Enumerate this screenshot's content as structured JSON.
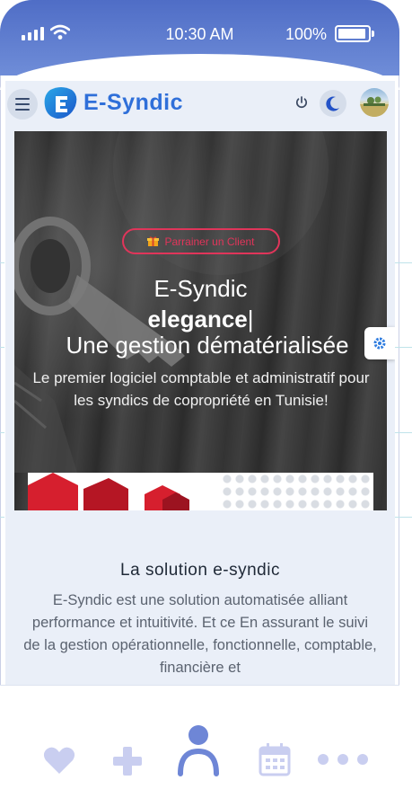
{
  "status_bar": {
    "time": "10:30 AM",
    "battery": "100%"
  },
  "header": {
    "brand": "E-Syndic"
  },
  "hero": {
    "cta": "Parrainer un Client",
    "title": "E-Syndic",
    "typed": "elegance",
    "cursor": "|",
    "subtitle": "Une gestion dématérialisée",
    "description": "Le premier logiciel comptable et administratif pour les syndics de copropriété en Tunisie!"
  },
  "section": {
    "title": "La solution e-syndic",
    "text": "E-Syndic est une solution automatisée alliant performance et intuitivité. Et ce En assurant le suivi de la gestion opérationnelle, fonctionnelle, comptable, financière et"
  },
  "colors": {
    "brand": "#2f6fd9",
    "status_bar": "#5c7ad0",
    "cta": "#e0355a",
    "nav_icon": "#c9cef0",
    "nav_active": "#6e86d6"
  },
  "icons": [
    "menu-icon",
    "logo-icon",
    "power-icon",
    "moon-icon",
    "gift-icon",
    "gear-icon",
    "heart-icon",
    "plus-icon",
    "user-icon",
    "calendar-icon",
    "more-icon"
  ]
}
